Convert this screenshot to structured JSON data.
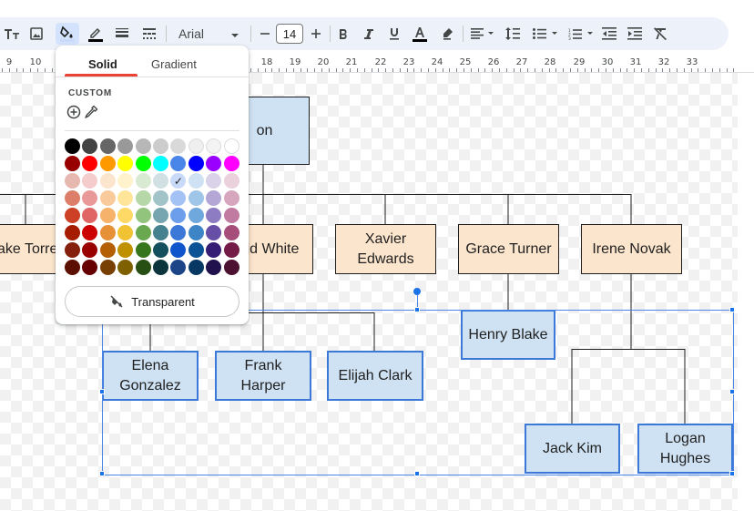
{
  "toolbar": {
    "font_name": "Arial",
    "font_size": "14",
    "icons": [
      "text-style-icon",
      "image-icon",
      "fill-color-icon",
      "border-color-icon",
      "border-weight-icon",
      "border-dash-icon",
      "decrease-font-icon",
      "increase-font-icon",
      "bold-icon",
      "italic-icon",
      "underline-icon",
      "text-color-icon",
      "highlight-icon",
      "align-icon",
      "line-spacing-icon",
      "bulleted-list-icon",
      "numbered-list-icon",
      "decrease-indent-icon",
      "increase-indent-icon",
      "clear-formatting-icon"
    ]
  },
  "ruler": {
    "numbers": [
      "9",
      "10",
      "18",
      "19",
      "20",
      "21",
      "22",
      "23",
      "24",
      "25",
      "26",
      "27",
      "28",
      "29",
      "30",
      "31",
      "32",
      "33"
    ]
  },
  "fill_popup": {
    "tabs": [
      "Solid",
      "Gradient"
    ],
    "active_tab": "Solid",
    "custom_label": "CUSTOM",
    "transparent_label": "Transparent",
    "selected_color": "#c9daf8",
    "palette": [
      [
        "#000000",
        "#434343",
        "#666666",
        "#999999",
        "#b7b7b7",
        "#cccccc",
        "#d9d9d9",
        "#efefef",
        "#f3f3f3",
        "#ffffff"
      ],
      [
        "#980000",
        "#ff0000",
        "#ff9900",
        "#ffff00",
        "#00ff00",
        "#00ffff",
        "#4a86e8",
        "#0000ff",
        "#9900ff",
        "#ff00ff"
      ],
      [
        "#e6b8af",
        "#f4cccc",
        "#fce5cd",
        "#fff2cc",
        "#d9ead3",
        "#d0e0e3",
        "#c9daf8",
        "#cfe2f3",
        "#d9d2e9",
        "#ead1dc"
      ],
      [
        "#dd7e6b",
        "#ea9999",
        "#f9cb9c",
        "#ffe599",
        "#b6d7a8",
        "#a2c4c9",
        "#a4c2f4",
        "#9fc5e8",
        "#b4a7d6",
        "#d5a6bd"
      ],
      [
        "#cc4125",
        "#e06666",
        "#f6b26b",
        "#ffd966",
        "#93c47d",
        "#76a5af",
        "#6d9eeb",
        "#6fa8dc",
        "#8e7cc3",
        "#c27ba0"
      ],
      [
        "#a61c00",
        "#cc0000",
        "#e69138",
        "#f1c232",
        "#6aa84f",
        "#45818e",
        "#3c78d8",
        "#3d85c6",
        "#674ea7",
        "#a64d79"
      ],
      [
        "#85200c",
        "#990000",
        "#b45f06",
        "#bf9000",
        "#38761d",
        "#134f5c",
        "#1155cc",
        "#0b5394",
        "#351c75",
        "#741b47"
      ],
      [
        "#5b0f00",
        "#660000",
        "#783f04",
        "#7f6000",
        "#274e13",
        "#0c343d",
        "#1c4587",
        "#073763",
        "#20124d",
        "#4c1130"
      ]
    ]
  },
  "chart": {
    "nodes": {
      "top": "on",
      "jake": "ake Torre",
      "david": "id White",
      "xavier": "Xavier Edwards",
      "grace": "Grace Turner",
      "irene": "Irene Novak",
      "henry": "Henry Blake",
      "elena": "Elena Gonzalez",
      "frank": "Frank Harper",
      "elijah": "Elijah Clark",
      "jack": "Jack Kim",
      "logan": "Logan Hughes"
    },
    "colors": {
      "peach": "#fce5cd",
      "blue": "#cfe2f3",
      "selection": "#4a86e8"
    }
  }
}
